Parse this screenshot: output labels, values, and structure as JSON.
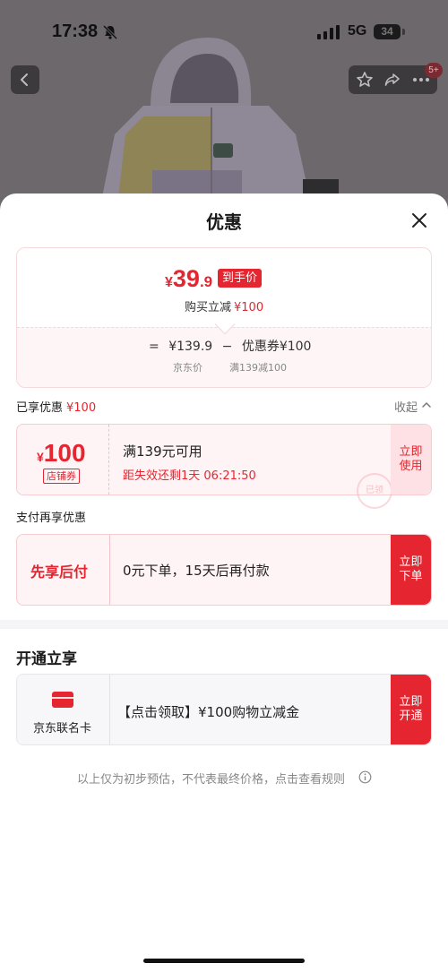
{
  "status_bar": {
    "time": "17:38",
    "network": "5G",
    "battery": "34"
  },
  "product_header": {
    "cart_badge": "5+"
  },
  "sheet": {
    "title": "优惠",
    "price_summary": {
      "final_price_yen": "¥",
      "final_price_int": "39",
      "final_price_dec": ".9",
      "final_tag": "到手价",
      "instant_cut_label": "购买立减",
      "instant_cut_amount": "¥100",
      "formula_eq": "=",
      "formula_jd_price": "¥139.9",
      "formula_minus": "−",
      "formula_coupon": "优惠券¥100",
      "jd_price_label": "京东价",
      "coupon_rule": "满139减100"
    },
    "enjoyed": {
      "label": "已享优惠",
      "amount": "¥100",
      "collapse": "收起"
    },
    "store_coupon": {
      "yen": "¥",
      "amount": "100",
      "type": "店铺券",
      "condition": "满139元可用",
      "timer": "距失效还剩1天 06:21:50",
      "button": "立即使用",
      "stamp": "已领"
    },
    "pay_section_label": "支付再享优惠",
    "pay_later": {
      "name": "先享后付",
      "description": "0元下单，15天后再付款",
      "button": "立即下单"
    },
    "open_section_title": "开通立享",
    "card_offer": {
      "name": "京东联名卡",
      "description": "【点击领取】¥100购物立减金",
      "button": "立即开通"
    },
    "disclaimer": "以上仅为初步预估，不代表最终价格，点击查看规则"
  },
  "colors": {
    "accent": "#e5252f",
    "coupon_bg": "#fff4f5",
    "overlay": "#6f6b6f"
  }
}
